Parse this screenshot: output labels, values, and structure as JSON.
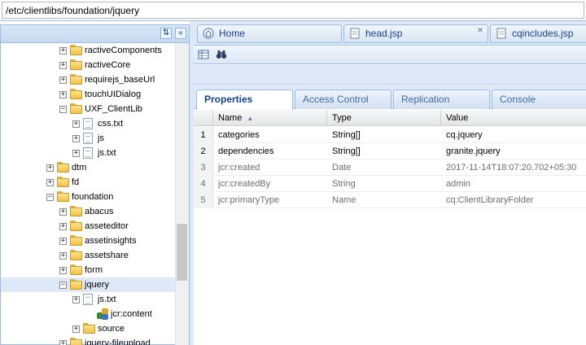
{
  "pathbar": {
    "path": "/etc/clientlibs/foundation/jquery"
  },
  "left_header": {
    "collapse_symbol": "«",
    "refresh_symbol": "⇅"
  },
  "tree": [
    {
      "label": "ractiveComponents",
      "type": "folder",
      "depth": 1,
      "expanded": false
    },
    {
      "label": "ractiveCore",
      "type": "folder",
      "depth": 1,
      "expanded": false
    },
    {
      "label": "requirejs_baseUrl",
      "type": "folder",
      "depth": 1,
      "expanded": false
    },
    {
      "label": "touchUIDialog",
      "type": "folder",
      "depth": 1,
      "expanded": false
    },
    {
      "label": "UXF_ClientLib",
      "type": "folder",
      "depth": 1,
      "expanded": true
    },
    {
      "label": "css.txt",
      "type": "file",
      "depth": 2,
      "expanded": false
    },
    {
      "label": "js",
      "type": "file",
      "depth": 2,
      "expanded": false
    },
    {
      "label": "js.txt",
      "type": "file",
      "depth": 2,
      "expanded": false
    },
    {
      "label": "dtm",
      "type": "folder",
      "depth": 0,
      "expanded": false
    },
    {
      "label": "fd",
      "type": "folder",
      "depth": 0,
      "expanded": false
    },
    {
      "label": "foundation",
      "type": "folder",
      "depth": 0,
      "expanded": true
    },
    {
      "label": "abacus",
      "type": "folder",
      "depth": 1,
      "expanded": false
    },
    {
      "label": "asseteditor",
      "type": "folder",
      "depth": 1,
      "expanded": false
    },
    {
      "label": "assetinsights",
      "type": "folder",
      "depth": 1,
      "expanded": false
    },
    {
      "label": "assetshare",
      "type": "folder",
      "depth": 1,
      "expanded": false
    },
    {
      "label": "form",
      "type": "folder",
      "depth": 1,
      "expanded": false
    },
    {
      "label": "jquery",
      "type": "folder",
      "depth": 1,
      "expanded": true,
      "selected": true
    },
    {
      "label": "js.txt",
      "type": "file",
      "depth": 2,
      "expanded": false
    },
    {
      "label": "jcr:content",
      "type": "node",
      "depth": 3,
      "expanded": false
    },
    {
      "label": "source",
      "type": "folder",
      "depth": 2,
      "expanded": false
    },
    {
      "label": "jquery-fileupload",
      "type": "folder",
      "depth": 1,
      "expanded": false
    }
  ],
  "editor_tabs": [
    {
      "label": "Home",
      "icon": "home-icon",
      "closable": false
    },
    {
      "label": "head.jsp",
      "icon": "file-icon",
      "closable": true
    },
    {
      "label": "cqincludes.jsp",
      "icon": "file-icon",
      "closable": false
    }
  ],
  "toolbar": {
    "icons": [
      "properties-grid-icon",
      "binoculars-icon"
    ]
  },
  "property_tabs": [
    {
      "label": "Properties",
      "active": true
    },
    {
      "label": "Access Control",
      "active": false
    },
    {
      "label": "Replication",
      "active": false
    },
    {
      "label": "Console",
      "active": false
    }
  ],
  "grid": {
    "columns": [
      "Name",
      "Type",
      "Value"
    ],
    "sort_indicator": "▲",
    "rows": [
      {
        "num": "1",
        "name": "categories",
        "type": "String[]",
        "value": "cq.jquery",
        "protected": false
      },
      {
        "num": "2",
        "name": "dependencies",
        "type": "String[]",
        "value": "granite.jquery",
        "protected": false
      },
      {
        "num": "3",
        "name": "jcr:created",
        "type": "Date",
        "value": "2017-11-14T18:07:20.702+05:30",
        "protected": true
      },
      {
        "num": "4",
        "name": "jcr:createdBy",
        "type": "String",
        "value": "admin",
        "protected": true
      },
      {
        "num": "5",
        "name": "jcr:primaryType",
        "type": "Name",
        "value": "cq:ClientLibraryFolder",
        "protected": true
      }
    ]
  },
  "colors": {
    "border": "#99bbe8",
    "panel": "#dfe8f6",
    "text_blue": "#15428b"
  }
}
